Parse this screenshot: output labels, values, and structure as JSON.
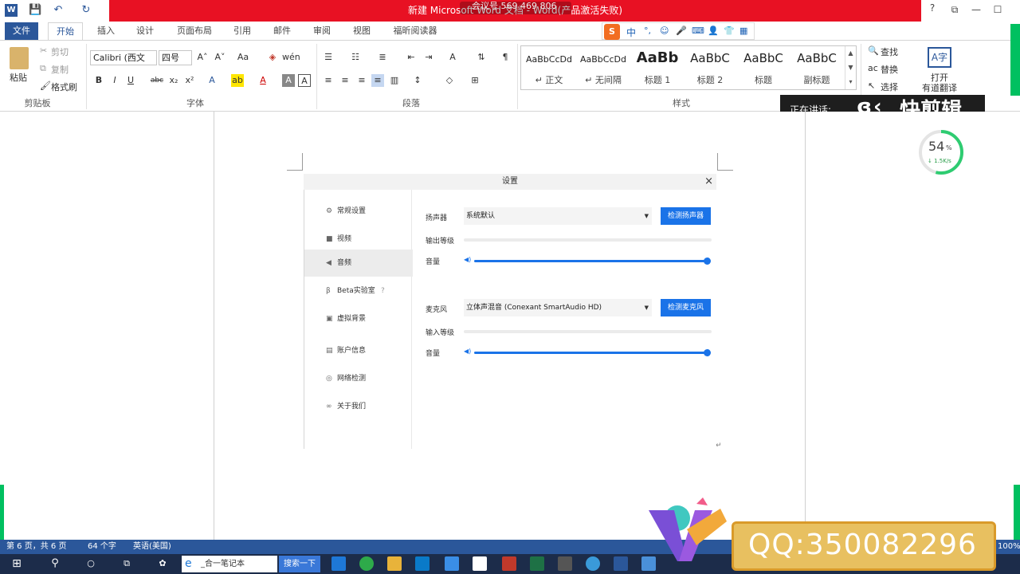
{
  "window": {
    "meeting_bar": "新建 Microsoft Word 文档 - Word(产品激活失败)",
    "meeting_id": "会议号 569 469 806",
    "help": "?",
    "controls": [
      "⧉",
      "—",
      "☐"
    ]
  },
  "quick_access": {
    "word_icon": "W",
    "save": "💾",
    "undo": "↶",
    "redo": "↻"
  },
  "tabs": [
    "文件",
    "开始",
    "插入",
    "设计",
    "页面布局",
    "引用",
    "邮件",
    "审阅",
    "视图",
    "福昕阅读器"
  ],
  "ime_bar": [
    "S",
    "中",
    "°,",
    "☺",
    "🎤",
    "⌨",
    "👤",
    "👕",
    "▦"
  ],
  "ribbon": {
    "clipboard": {
      "paste": "粘贴",
      "cut": "剪切",
      "copy": "复制",
      "format_painter": "格式刷",
      "group": "剪贴板"
    },
    "font": {
      "font_name": "Calibri (西文",
      "font_size": "四号",
      "group": "字体",
      "buttons_row1": [
        "A˄",
        "A˅",
        "Aa",
        "◈",
        "wén"
      ],
      "buttons_row2": [
        "B",
        "I",
        "U",
        "abc",
        "x₂",
        "x²",
        "A",
        "ab",
        "A",
        "A",
        "A"
      ]
    },
    "paragraph": {
      "group": "段落"
    },
    "styles": {
      "group": "样式",
      "items": [
        {
          "sample": "AaBbCcDd",
          "label": "↵ 正文"
        },
        {
          "sample": "AaBbCcDd",
          "label": "↵ 无间隔"
        },
        {
          "sample": "AaBb",
          "label": "标题 1"
        },
        {
          "sample": "AaBbC",
          "label": "标题 2"
        },
        {
          "sample": "AaBbC",
          "label": "标题"
        },
        {
          "sample": "AaBbC",
          "label": "副标题"
        }
      ]
    },
    "editing": {
      "find": "查找",
      "replace": "替换",
      "select": "选择",
      "translate_line1": "打开",
      "translate_line2": "有道翻译"
    }
  },
  "speaking_overlay": {
    "label": "正在讲话:",
    "brand": "快剪辑"
  },
  "gauge": {
    "percent": "54",
    "unit": "%",
    "speed": "↓ 1.5K/s",
    "value": 54
  },
  "settings_dialog": {
    "title": "设置",
    "close": "×",
    "sidebar": [
      {
        "icon": "⚙",
        "label": "常规设置",
        "active": false
      },
      {
        "icon": "■",
        "label": "视频",
        "active": false
      },
      {
        "icon": "◀",
        "label": "音频",
        "active": true
      },
      {
        "icon": "β",
        "label": "Beta实验室",
        "active": false,
        "help": "?"
      },
      {
        "icon": "▣",
        "label": "虚拟背景",
        "active": false
      },
      {
        "icon": "▤",
        "label": "账户信息",
        "active": false
      },
      {
        "icon": "◎",
        "label": "网络检测",
        "active": false
      },
      {
        "icon": "∞",
        "label": "关于我们",
        "active": false
      }
    ],
    "speaker": {
      "label": "扬声器",
      "value": "系统默认",
      "test_button": "检测扬声器"
    },
    "output_level": {
      "label": "输出等级",
      "value": 0
    },
    "speaker_volume": {
      "label": "音量",
      "value": 100
    },
    "mic": {
      "label": "麦克风",
      "value": "立体声混音 (Conexant SmartAudio HD)",
      "test_button": "检测麦克风"
    },
    "input_level": {
      "label": "输入等级",
      "value": 0
    },
    "mic_volume": {
      "label": "音量",
      "value": 100
    }
  },
  "status_bar": {
    "page": "第 6 页，共 6 页",
    "words": "64 个字",
    "language": "英语(美国)",
    "zoom": "100%"
  },
  "taskbar": {
    "task_label": "_合一笔记本",
    "search_button": "搜索一下"
  },
  "qq_banner": "QQ:350082296",
  "colors": {
    "word_blue": "#2b579a",
    "meeting_red": "#e81123",
    "accent_blue": "#1a73e8",
    "gauge_green": "#2ecc71",
    "banner_gold": "#e8c060"
  }
}
